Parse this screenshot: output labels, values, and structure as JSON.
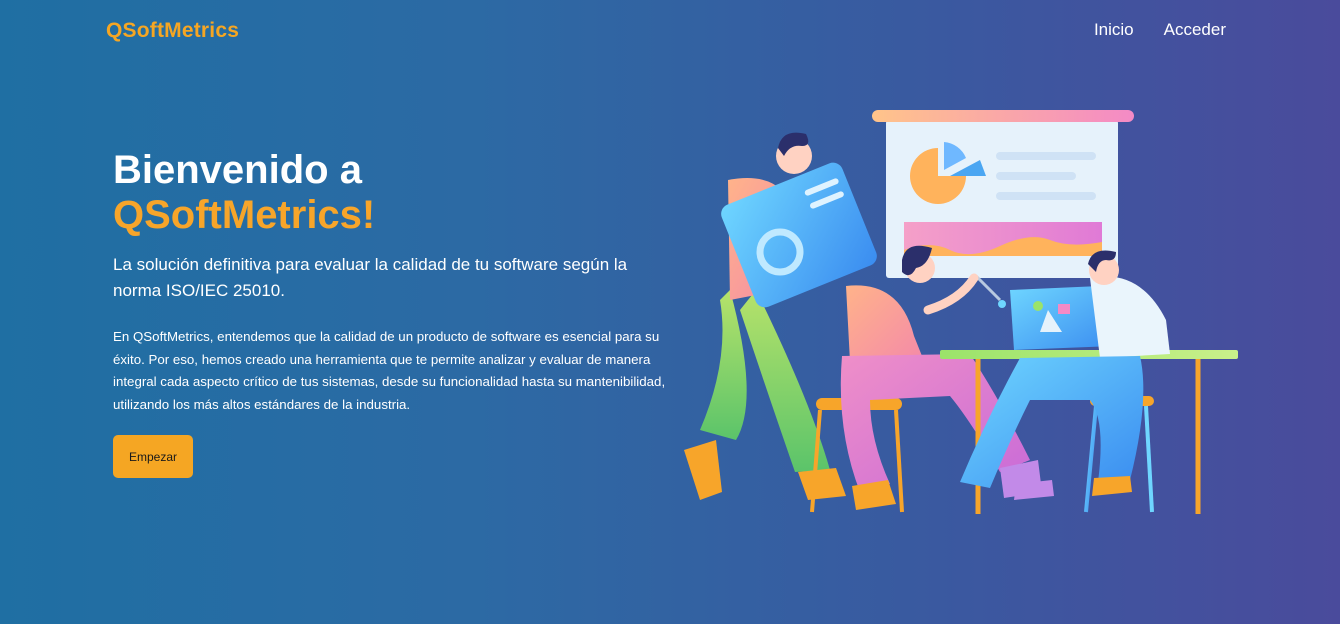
{
  "nav": {
    "brand": "QSoftMetrics",
    "links": [
      {
        "label": "Inicio"
      },
      {
        "label": "Acceder"
      }
    ]
  },
  "hero": {
    "title_line1": "Bienvenido a",
    "title_line2": "QSoftMetrics!",
    "subtitle": "La solución definitiva para evaluar la calidad de tu software según la norma ISO/IEC 25010.",
    "body": "En QSoftMetrics, entendemos que la calidad de un producto de software es esencial para su éxito. Por eso, hemos creado una herramienta que te permite analizar y evaluar de manera integral cada aspecto crítico de tus sistemas, desde su funcionalidad hasta su mantenibilidad, utilizando los más altos estándares de la industria.",
    "cta_label": "Empezar"
  },
  "colors": {
    "accent": "#f5a623",
    "background_start": "#1f6fa3",
    "background_end": "#4a4b9c"
  },
  "illustration": {
    "icon": "team-analytics-illustration"
  }
}
